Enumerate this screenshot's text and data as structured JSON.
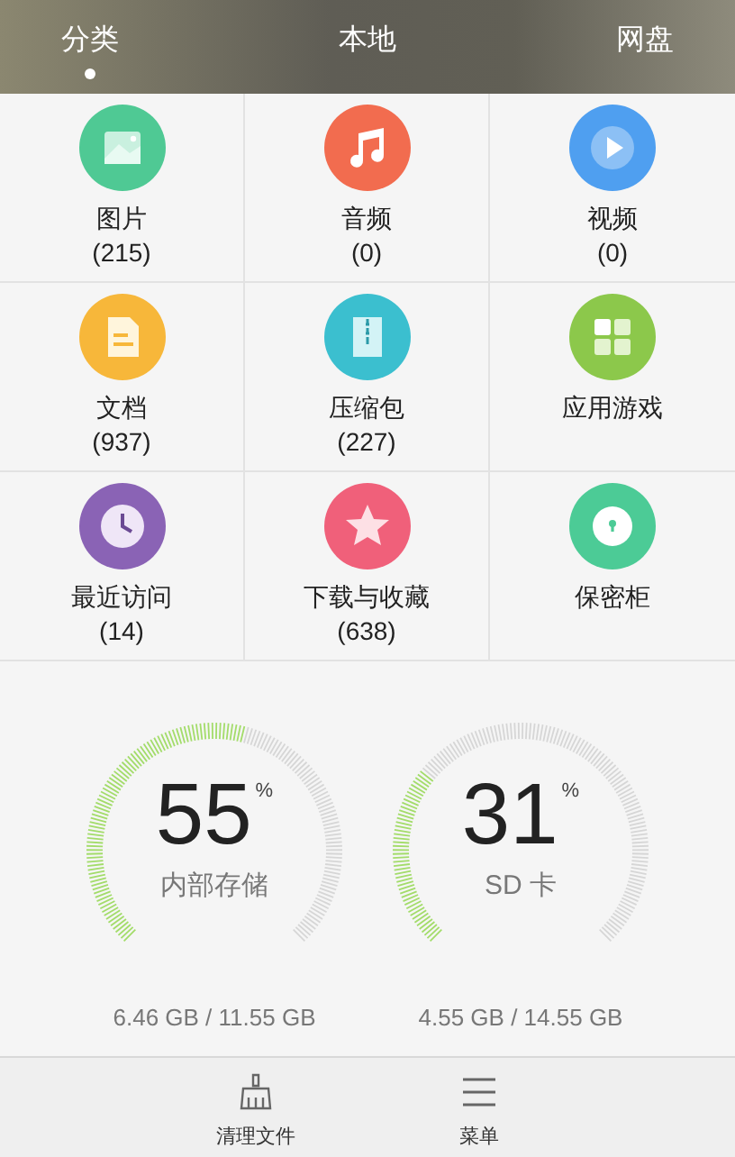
{
  "tabs": [
    {
      "label": "分类",
      "selected": true
    },
    {
      "label": "本地",
      "selected": false
    },
    {
      "label": "网盘",
      "selected": false
    }
  ],
  "categories": [
    {
      "label": "图片",
      "count": "(215)",
      "color": "#4fc994"
    },
    {
      "label": "音频",
      "count": "(0)",
      "color": "#f26c4f"
    },
    {
      "label": "视频",
      "count": "(0)",
      "color": "#4f9ff0"
    },
    {
      "label": "文档",
      "count": "(937)",
      "color": "#f7b73a"
    },
    {
      "label": "压缩包",
      "count": "(227)",
      "color": "#3bbfcf"
    },
    {
      "label": "应用游戏",
      "color": "#8cc84b"
    },
    {
      "label": "最近访问",
      "count": "(14)",
      "color": "#8a63b5"
    },
    {
      "label": "下载与收藏",
      "count": "(638)",
      "color": "#f0607a"
    },
    {
      "label": "保密柜",
      "color": "#4ccb96"
    }
  ],
  "storage": [
    {
      "percent": "55",
      "unit": "%",
      "label": "内部存储",
      "usage": "6.46 GB / 11.55 GB"
    },
    {
      "percent": "31",
      "unit": "%",
      "label": "SD 卡",
      "usage": "4.55 GB / 14.55 GB"
    }
  ],
  "bottom_bar": [
    {
      "label": "清理文件"
    },
    {
      "label": "菜单"
    }
  ]
}
